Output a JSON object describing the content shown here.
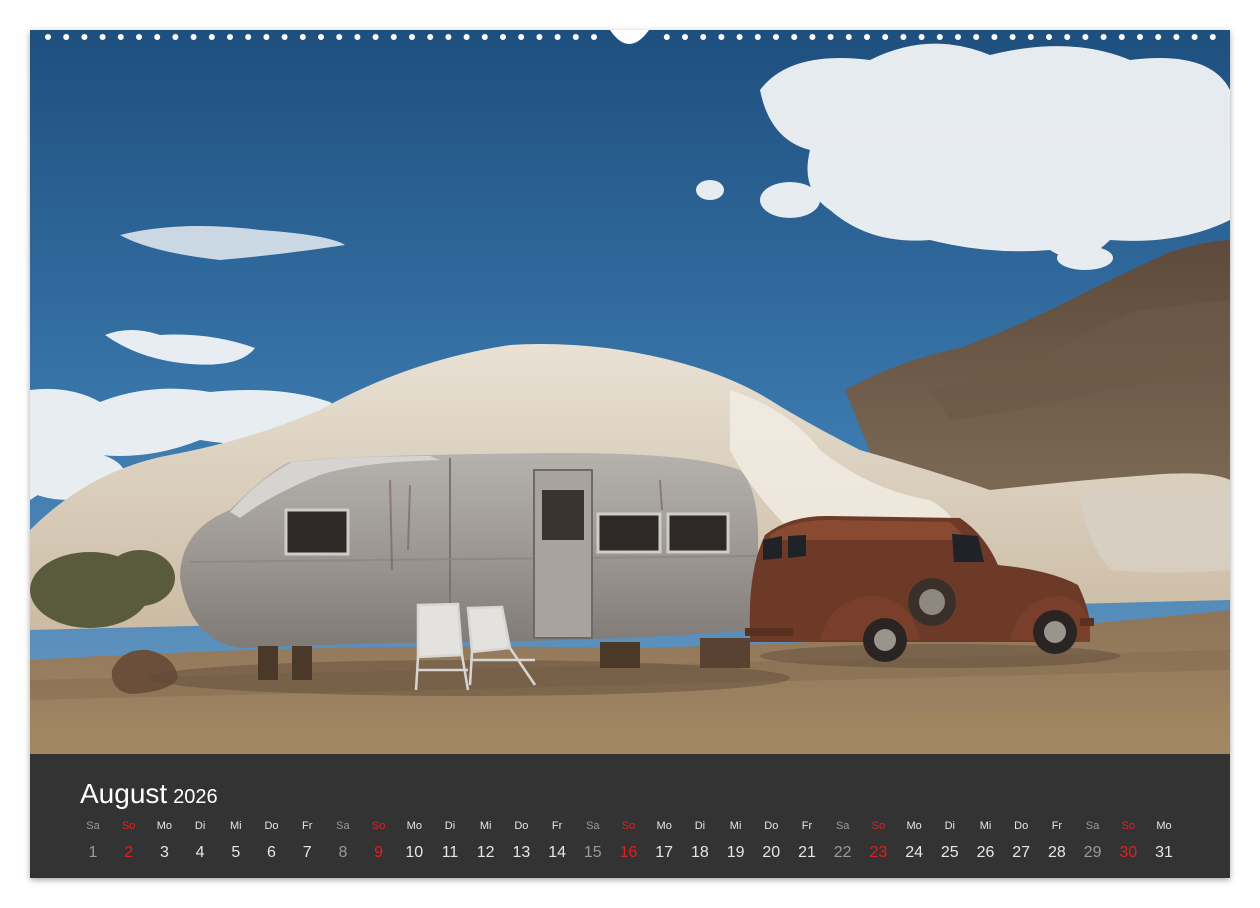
{
  "calendar": {
    "month": "August",
    "year": "2026",
    "weekday_labels": [
      "Sa",
      "So",
      "Mo",
      "Di",
      "Mi",
      "Do",
      "Fr",
      "Sa",
      "So",
      "Mo",
      "Di",
      "Mi",
      "Do",
      "Fr",
      "Sa",
      "So",
      "Mo",
      "Di",
      "Mi",
      "Do",
      "Fr",
      "Sa",
      "So",
      "Mo",
      "Di",
      "Mi",
      "Do",
      "Fr",
      "Sa",
      "So",
      "Mo"
    ],
    "days": [
      "1",
      "2",
      "3",
      "4",
      "5",
      "6",
      "7",
      "8",
      "9",
      "10",
      "11",
      "12",
      "13",
      "14",
      "15",
      "16",
      "17",
      "18",
      "19",
      "20",
      "21",
      "22",
      "23",
      "24",
      "25",
      "26",
      "27",
      "28",
      "29",
      "30",
      "31"
    ],
    "colors": {
      "saturday": "#9a9a9a",
      "sunday": "#e02020",
      "weekday": "#e6e6e6",
      "band": "#333333"
    }
  },
  "photo": {
    "subject": [
      "sky-with-clouds",
      "white-rock-hill",
      "rocky-mountain",
      "vintage-travel-trailer",
      "rusty-panel-truck",
      "two-metal-chairs",
      "desert-ground"
    ]
  }
}
